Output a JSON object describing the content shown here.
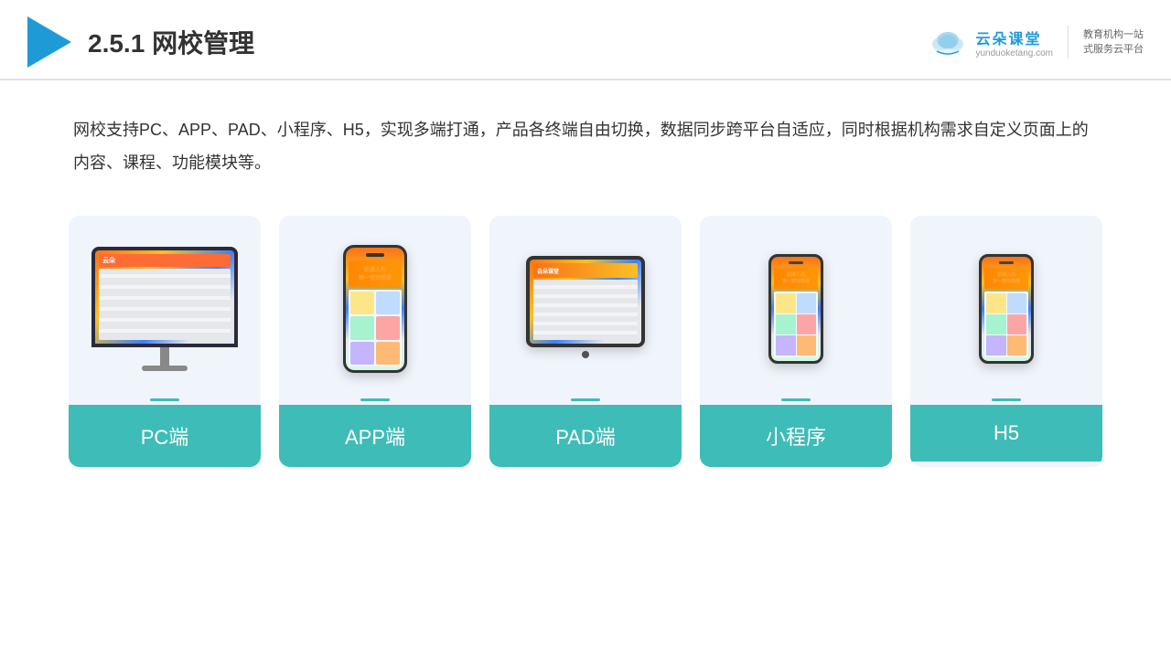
{
  "header": {
    "title": "网校管理",
    "number": "2.5.1",
    "brand": {
      "name": "云朵课堂",
      "url": "yunduoketang.com",
      "slogan": "教育机构一站\n式服务云平台"
    }
  },
  "description": {
    "text": "网校支持PC、APP、PAD、小程序、H5，实现多端打通，产品各终端自由切换，数据同步跨平台自适应，同时根据机构需求自定义页面上的内容、课程、功能模块等。"
  },
  "cards": [
    {
      "id": "pc",
      "label": "PC端",
      "device": "pc"
    },
    {
      "id": "app",
      "label": "APP端",
      "device": "phone"
    },
    {
      "id": "pad",
      "label": "PAD端",
      "device": "tablet"
    },
    {
      "id": "mini",
      "label": "小程序",
      "device": "phone-mini"
    },
    {
      "id": "h5",
      "label": "H5",
      "device": "phone-mini2"
    }
  ],
  "colors": {
    "accent": "#3dbcb8",
    "header_line": "#1e9bd7",
    "card_bg": "#eef2fb"
  }
}
